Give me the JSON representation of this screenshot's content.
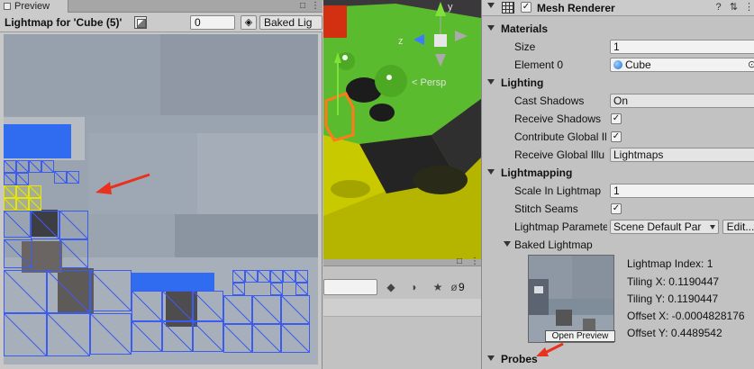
{
  "preview": {
    "tab_label": "Preview",
    "title": "Lightmap for 'Cube (5)'",
    "lightmap_index_field": "0",
    "mode_dropdown": "Baked Lig"
  },
  "scene": {
    "persp_label": "< Persp",
    "axis_y": "y",
    "axis_z": "z"
  },
  "hierarchy": {
    "hidden_count": "9"
  },
  "inspector": {
    "component_title": "Mesh Renderer",
    "component_enabled": true,
    "materials": {
      "header": "Materials",
      "size_label": "Size",
      "size_value": "1",
      "element0_label": "Element 0",
      "element0_value": "Cube"
    },
    "lighting": {
      "header": "Lighting",
      "cast_shadows_label": "Cast Shadows",
      "cast_shadows_value": "On",
      "receive_shadows_label": "Receive Shadows",
      "receive_shadows_checked": true,
      "contribute_gi_label": "Contribute Global Il",
      "contribute_gi_checked": true,
      "receive_gi_label": "Receive Global Illu",
      "receive_gi_value": "Lightmaps"
    },
    "lightmapping": {
      "header": "Lightmapping",
      "scale_label": "Scale In Lightmap",
      "scale_value": "1",
      "stitch_label": "Stitch Seams",
      "stitch_checked": true,
      "params_label": "Lightmap Paramete",
      "params_value": "Scene Default Par",
      "edit_button": "Edit..."
    },
    "baked_lightmap": {
      "header": "Baked Lightmap",
      "open_preview_button": "Open Preview",
      "lightmap_index": "Lightmap Index: 1",
      "tiling_x": "Tiling X: 0.1190447",
      "tiling_y": "Tiling Y: 0.1190447",
      "offset_x": "Offset X: -0.0004828176",
      "offset_y": "Offset Y: 0.4489542"
    },
    "probes": {
      "header": "Probes"
    }
  },
  "colors": {
    "uv_wire": "#3b5cf0",
    "selected_uv": "#e6e600",
    "annotation_arrow": "#e8321e",
    "scene_floor": "#c8c800",
    "scene_platform": "#55b72c"
  }
}
